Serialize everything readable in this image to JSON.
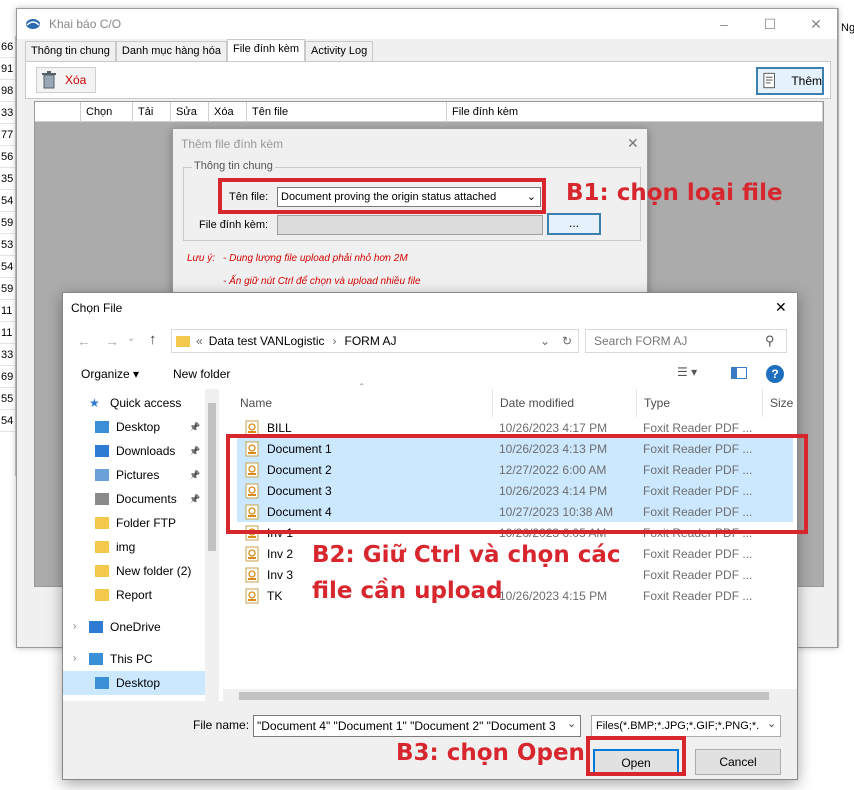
{
  "left_strip": [
    "66",
    "91",
    "98",
    "33",
    "77",
    "56",
    "35",
    "54",
    "59",
    "53",
    "54",
    "59",
    "11",
    "11",
    "33",
    "69",
    "55",
    "54"
  ],
  "right_strip_top": "Ng",
  "window": {
    "title": "Khai báo C/O",
    "tabs": [
      "Thông tin chung",
      "Danh mục hàng hóa",
      "File đính kèm",
      "Activity Log"
    ],
    "delete_label": "Xóa",
    "add_label": "Thêm",
    "grid_columns": [
      "Chọn",
      "Tải",
      "Sửa",
      "Xóa",
      "Tên file",
      "File đính kèm"
    ]
  },
  "attach_dialog": {
    "title": "Thêm file đính kèm",
    "group_label": "Thông tin chung",
    "filename_label": "Tên file:",
    "filename_value": "Document proving the origin status attached",
    "attach_label": "File đính kèm:",
    "browse_label": "...",
    "note_prefix": "Lưu ý:",
    "note_1": "- Dung lượng file upload phải nhỏ hơn 2M",
    "note_2": "- Ấn giữ nút Ctrl để chọn và upload nhiều file"
  },
  "file_dialog": {
    "title": "Chọn File",
    "breadcrumb_prefix": "«",
    "breadcrumb": [
      "Data test VANLogistic",
      "FORM AJ"
    ],
    "search_placeholder": "Search FORM AJ",
    "organize_label": "Organize",
    "new_folder_label": "New folder",
    "nav_items": [
      {
        "label": "Quick access",
        "icon": "star-icon"
      },
      {
        "label": "Desktop",
        "icon": "desktop-icon",
        "pinned": true
      },
      {
        "label": "Downloads",
        "icon": "download-icon",
        "pinned": true
      },
      {
        "label": "Pictures",
        "icon": "pictures-icon",
        "pinned": true
      },
      {
        "label": "Documents",
        "icon": "documents-icon",
        "pinned": true
      },
      {
        "label": "Folder FTP",
        "icon": "folder-icon"
      },
      {
        "label": "img",
        "icon": "folder-icon"
      },
      {
        "label": "New folder (2)",
        "icon": "folder-icon"
      },
      {
        "label": "Report",
        "icon": "folder-icon"
      },
      {
        "label": "OneDrive",
        "icon": "onedrive-icon"
      },
      {
        "label": "This PC",
        "icon": "pc-icon"
      },
      {
        "label": "Desktop",
        "icon": "desktop-icon"
      }
    ],
    "columns": [
      "Name",
      "Date modified",
      "Type",
      "Size"
    ],
    "files": [
      {
        "name": "BILL",
        "date": "10/26/2023 4:17 PM",
        "type": "Foxit Reader PDF ...",
        "selected": false
      },
      {
        "name": "Document 1",
        "date": "10/26/2023 4:13 PM",
        "type": "Foxit Reader PDF ...",
        "selected": true
      },
      {
        "name": "Document 2",
        "date": "12/27/2022 6:00 AM",
        "type": "Foxit Reader PDF ...",
        "selected": true
      },
      {
        "name": "Document 3",
        "date": "10/26/2023 4:14 PM",
        "type": "Foxit Reader PDF ...",
        "selected": true
      },
      {
        "name": "Document 4",
        "date": "10/27/2023 10:38 AM",
        "type": "Foxit Reader PDF ...",
        "selected": true
      },
      {
        "name": "Inv 1",
        "date": "10/26/2023 6:05 AM",
        "type": "Foxit Reader PDF ...",
        "selected": false
      },
      {
        "name": "Inv 2",
        "date": "",
        "type": "Foxit Reader PDF ...",
        "selected": false
      },
      {
        "name": "Inv 3",
        "date": "",
        "type": "Foxit Reader PDF ...",
        "selected": false
      },
      {
        "name": "TK",
        "date": "10/26/2023 4:15 PM",
        "type": "Foxit Reader PDF ...",
        "selected": false
      }
    ],
    "filename_label": "File name:",
    "filename_value": "\"Document 4\" \"Document 1\" \"Document 2\" \"Document 3",
    "filetype_value": "Files(*.BMP;*.JPG;*.GIF;*.PNG;*.",
    "open_label": "Open",
    "cancel_label": "Cancel"
  },
  "annotations": {
    "step1": "B1: chọn loại file",
    "step2_line1": "B2: Giữ Ctrl và chọn các",
    "step2_line2": "file cần upload",
    "step3": "B3: chọn Open",
    "color": "#d8262e"
  }
}
